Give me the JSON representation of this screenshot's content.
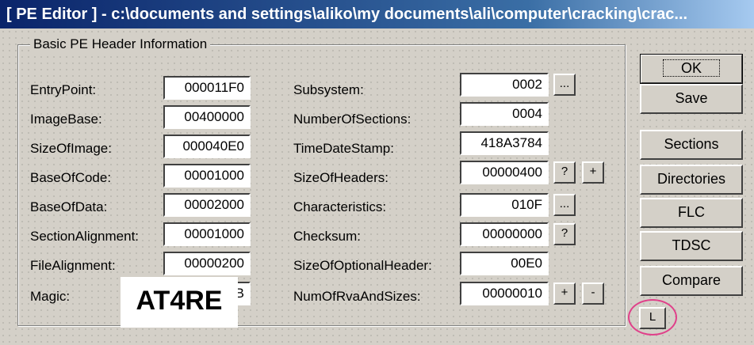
{
  "window": {
    "title": "[ PE Editor ] - c:\\documents and settings\\aliko\\my documents\\ali\\computer\\cracking\\crac..."
  },
  "group": {
    "title": "Basic PE Header Information"
  },
  "left_fields": [
    {
      "label": "EntryPoint:",
      "value": "000011F0"
    },
    {
      "label": "ImageBase:",
      "value": "00400000"
    },
    {
      "label": "SizeOfImage:",
      "value": "000040E0"
    },
    {
      "label": "BaseOfCode:",
      "value": "00001000"
    },
    {
      "label": "BaseOfData:",
      "value": "00002000"
    },
    {
      "label": "SectionAlignment:",
      "value": "00001000"
    },
    {
      "label": "FileAlignment:",
      "value": "00000200"
    },
    {
      "label": "Magic:",
      "value": "B"
    }
  ],
  "right_fields": [
    {
      "label": "Subsystem:",
      "value": "0002"
    },
    {
      "label": "NumberOfSections:",
      "value": "0004"
    },
    {
      "label": "TimeDateStamp:",
      "value": "418A3784"
    },
    {
      "label": "SizeOfHeaders:",
      "value": "00000400"
    },
    {
      "label": "Characteristics:",
      "value": "010F"
    },
    {
      "label": "Checksum:",
      "value": "00000000"
    },
    {
      "label": "SizeOfOptionalHeader:",
      "value": "00E0"
    },
    {
      "label": "NumOfRvaAndSizes:",
      "value": "00000010"
    }
  ],
  "small_buttons": {
    "subsystem_more": "...",
    "headers_query": "?",
    "headers_plus": "+",
    "characteristics_more": "...",
    "checksum_query": "?",
    "rva_plus": "+",
    "rva_minus": "-"
  },
  "buttons": {
    "ok": "OK",
    "save": "Save",
    "sections": "Sections",
    "directories": "Directories",
    "flc": "FLC",
    "tdsc": "TDSC",
    "compare": "Compare",
    "l": "L"
  },
  "watermark": "AT4RE",
  "colors": {
    "title_start": "#0a246a",
    "title_end": "#a6caf0",
    "face": "#d4d0c8",
    "highlight_circle": "#e0408a"
  }
}
